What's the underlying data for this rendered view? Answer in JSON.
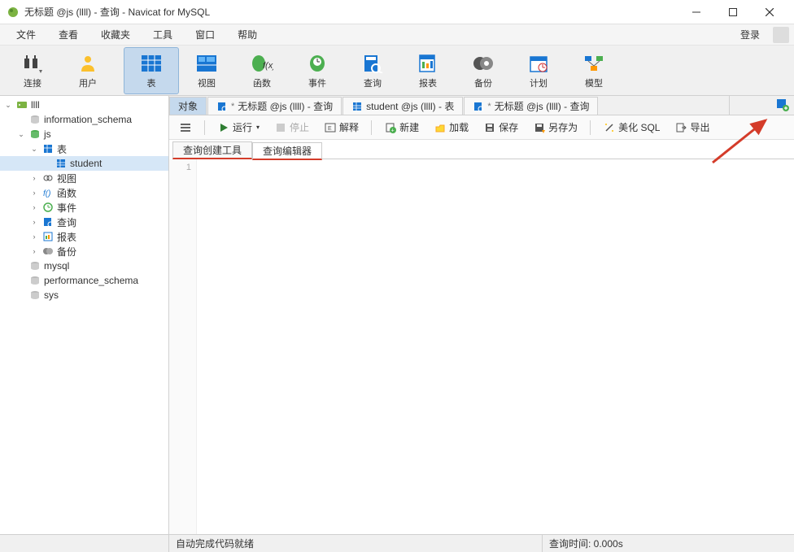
{
  "window": {
    "title": "无标题 @js (llll) - 查询 - Navicat for MySQL"
  },
  "menu": {
    "items": [
      "文件",
      "查看",
      "收藏夹",
      "工具",
      "窗口",
      "帮助"
    ],
    "login": "登录"
  },
  "toolbar": {
    "items": [
      {
        "id": "connection",
        "label": "连接",
        "icon": "plug"
      },
      {
        "id": "user",
        "label": "用户",
        "icon": "user"
      },
      {
        "id": "table",
        "label": "表",
        "icon": "table",
        "active": true
      },
      {
        "id": "view",
        "label": "视图",
        "icon": "view"
      },
      {
        "id": "function",
        "label": "函数",
        "icon": "fx"
      },
      {
        "id": "event",
        "label": "事件",
        "icon": "event"
      },
      {
        "id": "query",
        "label": "查询",
        "icon": "query"
      },
      {
        "id": "report",
        "label": "报表",
        "icon": "report"
      },
      {
        "id": "backup",
        "label": "备份",
        "icon": "backup"
      },
      {
        "id": "schedule",
        "label": "计划",
        "icon": "schedule"
      },
      {
        "id": "model",
        "label": "模型",
        "icon": "model"
      }
    ]
  },
  "tree": [
    {
      "depth": 0,
      "toggle": "v",
      "icon": "server",
      "label": "llll"
    },
    {
      "depth": 1,
      "toggle": "",
      "icon": "db",
      "label": "information_schema"
    },
    {
      "depth": 1,
      "toggle": "v",
      "icon": "db-open",
      "label": "js"
    },
    {
      "depth": 2,
      "toggle": "v",
      "icon": "tables",
      "label": "表"
    },
    {
      "depth": 3,
      "toggle": "",
      "icon": "table",
      "label": "student",
      "selected": true
    },
    {
      "depth": 2,
      "toggle": ">",
      "icon": "views",
      "label": "视图"
    },
    {
      "depth": 2,
      "toggle": ">",
      "icon": "fx",
      "label": "函数"
    },
    {
      "depth": 2,
      "toggle": ">",
      "icon": "event",
      "label": "事件"
    },
    {
      "depth": 2,
      "toggle": ">",
      "icon": "query",
      "label": "查询"
    },
    {
      "depth": 2,
      "toggle": ">",
      "icon": "report",
      "label": "报表"
    },
    {
      "depth": 2,
      "toggle": ">",
      "icon": "backup",
      "label": "备份"
    },
    {
      "depth": 1,
      "toggle": "",
      "icon": "db",
      "label": "mysql"
    },
    {
      "depth": 1,
      "toggle": "",
      "icon": "db",
      "label": "performance_schema"
    },
    {
      "depth": 1,
      "toggle": "",
      "icon": "db",
      "label": "sys"
    }
  ],
  "content_tabs": {
    "items": [
      {
        "id": "objects",
        "label": "对象",
        "active": true,
        "selected": true
      },
      {
        "id": "q1",
        "label": "无标题 @js (llll) - 查询",
        "icon": "query",
        "dirty": true
      },
      {
        "id": "t1",
        "label": "student @js (llll) - 表",
        "icon": "table"
      },
      {
        "id": "q2",
        "label": "无标题 @js (llll) - 查询",
        "icon": "query",
        "dirty": true
      }
    ]
  },
  "actions": {
    "menu": "≡",
    "run": "运行",
    "stop": "停止",
    "explain": "解释",
    "new": "新建",
    "load": "加载",
    "save": "保存",
    "saveas": "另存为",
    "beautify": "美化 SQL",
    "export": "导出"
  },
  "editor_tabs": {
    "builder": "查询创建工具",
    "editor": "查询编辑器"
  },
  "gutter": {
    "line1": "1"
  },
  "status": {
    "completion": "自动完成代码就绪",
    "query_time": "查询时间: 0.000s"
  }
}
